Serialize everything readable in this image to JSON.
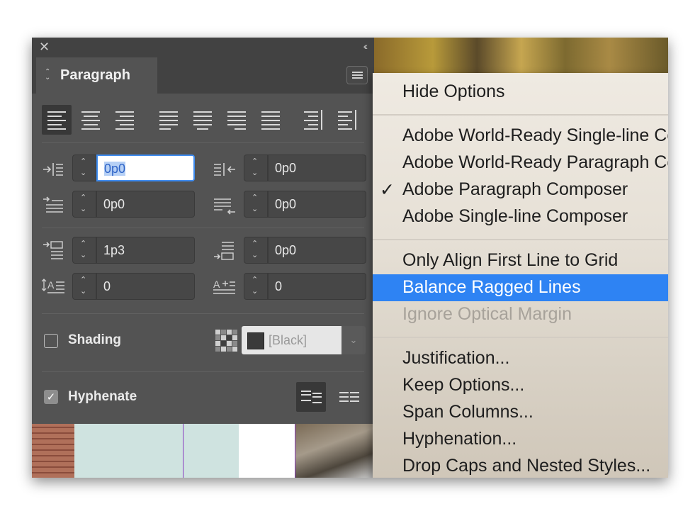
{
  "panel": {
    "title": "Paragraph",
    "close_glyph": "✕",
    "collapse_glyph": "‹‹",
    "indents": {
      "left_indent": "0p0",
      "right_indent": "0p0",
      "first_line_indent": "0p0",
      "last_line_indent": "0p0",
      "space_before": "1p3",
      "space_after": "0p0",
      "drop_cap_lines": "0",
      "drop_cap_chars": "0"
    },
    "shading": {
      "label": "Shading",
      "checked": false,
      "color_value": "[Black]"
    },
    "hyphenate": {
      "label": "Hyphenate",
      "checked": true
    }
  },
  "menu": {
    "items": [
      {
        "label": "Hide Options",
        "state": "normal"
      },
      {
        "label": "Adobe World-Ready Single-line Composer",
        "state": "normal"
      },
      {
        "label": "Adobe World-Ready Paragraph Composer",
        "state": "normal"
      },
      {
        "label": "Adobe Paragraph Composer",
        "state": "checked"
      },
      {
        "label": "Adobe Single-line Composer",
        "state": "normal"
      },
      {
        "label": "Only Align First Line to Grid",
        "state": "normal"
      },
      {
        "label": "Balance Ragged Lines",
        "state": "highlighted"
      },
      {
        "label": "Ignore Optical Margin",
        "state": "disabled"
      },
      {
        "label": "Justification...",
        "state": "normal"
      },
      {
        "label": "Keep Options...",
        "state": "normal"
      },
      {
        "label": "Span Columns...",
        "state": "normal"
      },
      {
        "label": "Hyphenation...",
        "state": "normal"
      },
      {
        "label": "Drop Caps and Nested Styles...",
        "state": "normal"
      }
    ],
    "check_glyph": "✓"
  },
  "colors": {
    "highlight": "#2e83f3",
    "panel_bg": "#535353",
    "focus_border": "#3f8cf0"
  }
}
